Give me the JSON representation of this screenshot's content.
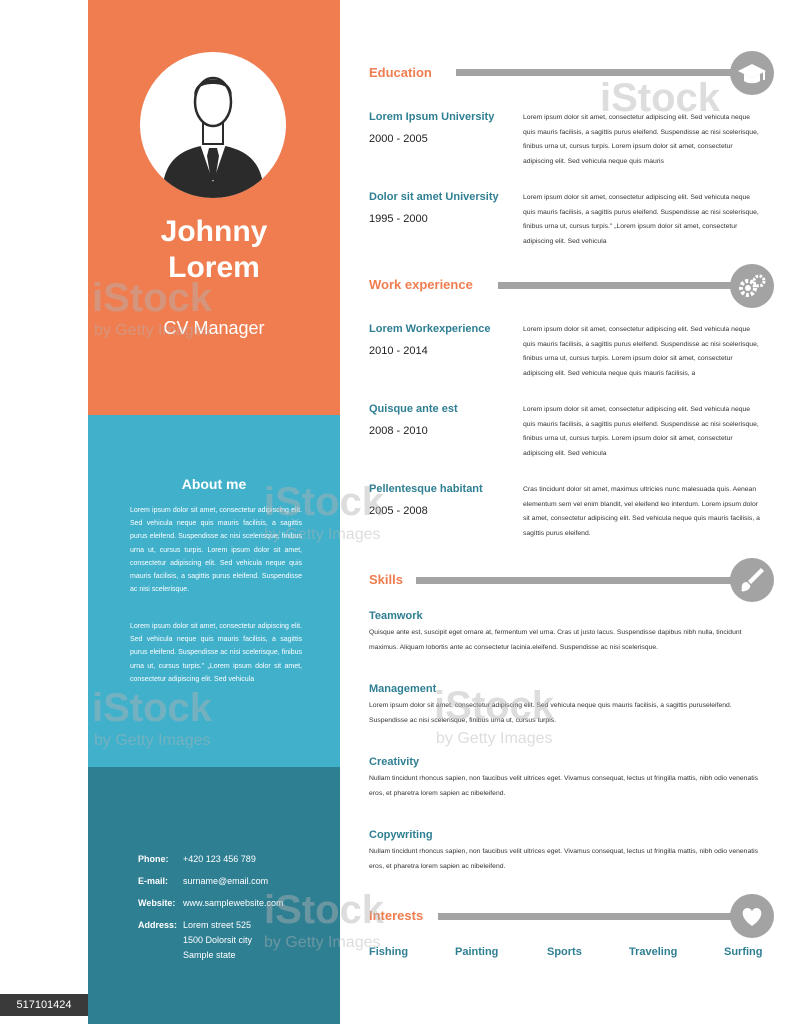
{
  "profile": {
    "first_name": "Johnny",
    "last_name": "Lorem",
    "role": "CV Manager"
  },
  "about": {
    "title": "About me",
    "paragraph1": "Lorem ipsum dolor sit amet, consectetur adipiscing elit. Sed vehicula neque quis mauris facilisis, a sagittis purus eleifend. Suspendisse ac nisi scelerisque, finibus urna ut, cursus turpis. Lorem ipsum dolor sit amet, consectetur adipiscing elit. Sed vehicula neque quis mauris facilisis, a sagittis purus eleifend. Suspendisse ac nisi scelerisque.",
    "paragraph2": "Lorem ipsum dolor sit amet, consectetur adipiscing elit. Sed vehicula neque quis mauris facilisis, a sagittis purus eleifend. Suspendisse ac nisi scelerisque, finibus urna ut, cursus turpis.\" „Lorem ipsum dolor sit amet, consectetur adipiscing elit. Sed vehicula"
  },
  "contact": {
    "phone_label": "Phone:",
    "phone": "+420 123 456 789",
    "email_label": "E-mail:",
    "email": "surname@email.com",
    "website_label": "Website:",
    "website": "www.samplewebsite.com",
    "address_label": "Address:",
    "address_line1": "Lorem street 525",
    "address_line2": "1500 Dolorsit city",
    "address_line3": "Sample state"
  },
  "education": {
    "title": "Education",
    "icon": "graduation-cap-icon",
    "entries": [
      {
        "title": "Lorem Ipsum University",
        "dates": "2000 - 2005",
        "desc": "Lorem ipsum dolor sit amet, consectetur adipiscing elit. Sed vehicula neque quis mauris facilisis, a sagittis purus eleifend. Suspendisse ac nisi scelerisque, finibus urna ut, cursus turpis. Lorem ipsum dolor sit amet, consectetur adipiscing elit. Sed vehicula neque quis mauris"
      },
      {
        "title": "Dolor sit amet University",
        "dates": "1995 - 2000",
        "desc": "Lorem ipsum dolor sit amet, consectetur adipiscing elit. Sed vehicula neque quis mauris facilisis, a sagittis purus eleifend. Suspendisse ac nisi scelerisque, finibus urna ut, cursus turpis.\" „Lorem ipsum dolor sit amet, consectetur adipiscing elit. Sed vehicula"
      }
    ]
  },
  "work": {
    "title": "Work experience",
    "icon": "gears-icon",
    "entries": [
      {
        "title": "Lorem Workexperience",
        "dates": "2010 - 2014",
        "desc": "Lorem ipsum dolor sit amet, consectetur adipiscing elit. Sed vehicula neque quis mauris facilisis, a sagittis purus eleifend. Suspendisse ac nisi scelerisque, finibus urna ut, cursus turpis. Lorem ipsum dolor sit amet, consectetur adipiscing elit. Sed vehicula neque quis mauris facilisis, a"
      },
      {
        "title": "Quisque ante est",
        "dates": "2008 - 2010",
        "desc": "Lorem ipsum dolor sit amet, consectetur adipiscing elit. Sed vehicula neque quis mauris facilisis, a sagittis purus eleifend. Suspendisse ac nisi scelerisque, finibus urna ut, cursus turpis. Lorem ipsum dolor sit amet, consectetur adipiscing elit. Sed vehicula"
      },
      {
        "title": "Pellentesque habitant",
        "dates": "2005 - 2008",
        "desc": "Cras tincidunt dolor sit amet, maximus ultricies nunc malesuada quis. Aenean elementum sem vel enim blandit, vel eleifend leo interdum. Lorem ipsum dolor sit amet, consectetur adipiscing elit. Sed vehicula neque quis mauris facilisis, a sagittis purus eleifend."
      }
    ]
  },
  "skills": {
    "title": "Skills",
    "icon": "brush-icon",
    "entries": [
      {
        "title": "Teamwork",
        "desc": "Quisque ante est, suscipit eget ornare at, fermentum vel urna. Cras ut justo lacus. Suspendisse dapibus nibh nulla, tincidunt maximus. Aliquam lobortis ante ac consectetur lacinia.eleifend. Suspendisse ac nisi scelerisque."
      },
      {
        "title": "Management",
        "desc": "Lorem ipsum dolor sit amet, consectetur adipiscing elit. Sed vehicula neque quis mauris facilisis, a sagittis puruseleifend. Suspendisse ac nisi scelerisque, finibus urna ut, cursus turpis."
      },
      {
        "title": "Creativity",
        "desc": "Nullam tincidunt rhoncus sapien, non faucibus velit ultrices eget. Vivamus consequat, lectus ut fringilla mattis, nibh odio venenatis eros, et pharetra lorem sapien ac nibeleifend."
      },
      {
        "title": "Copywriting",
        "desc": "Nullam tincidunt rhoncus sapien, non faucibus velit ultrices eget. Vivamus consequat, lectus ut fringilla mattis, nibh odio venenatis eros, et pharetra lorem sapien ac nibeleifend."
      }
    ]
  },
  "interests": {
    "title": "Interests",
    "icon": "heart-icon",
    "items": [
      "Fishing",
      "Painting",
      "Sports",
      "Traveling",
      "Surfing"
    ]
  },
  "watermark": {
    "brand": "iStock",
    "credit": "by Getty Images",
    "stock_id": "517101424"
  },
  "colors": {
    "orange": "#f07d50",
    "light_blue": "#40b0cb",
    "dark_blue": "#2f7f93",
    "gray": "#a3a3a3"
  }
}
